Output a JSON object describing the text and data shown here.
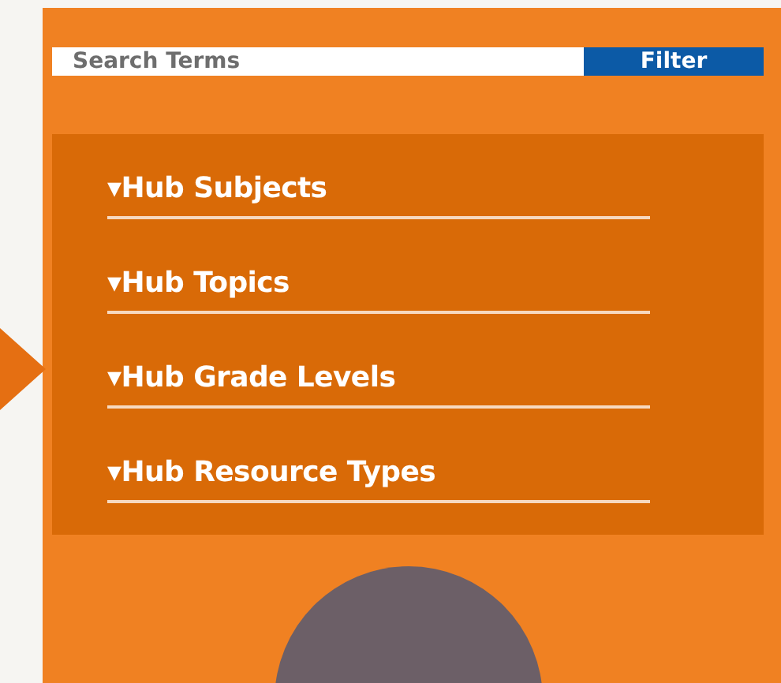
{
  "search": {
    "placeholder": "Search Terms",
    "button": "Filter"
  },
  "filters": [
    {
      "label": "▾Hub Subjects"
    },
    {
      "label": "▾Hub Topics"
    },
    {
      "label": "▾Hub Grade Levels"
    },
    {
      "label": "▾Hub Resource Types"
    }
  ]
}
